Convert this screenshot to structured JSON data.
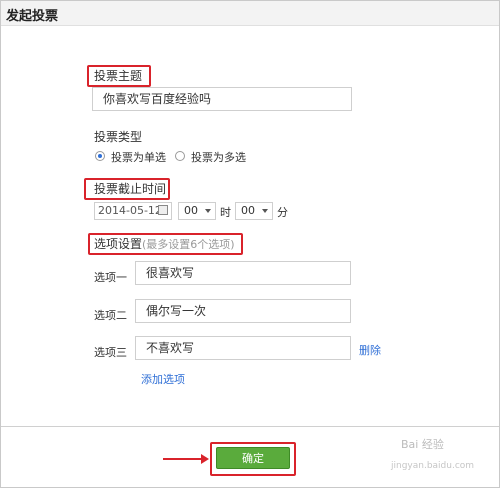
{
  "dialog": {
    "title": "发起投票"
  },
  "vote": {
    "topic_label": "投票主题",
    "topic_value": "你喜欢写百度经验吗",
    "type_label": "投票类型",
    "type_single": "投票为单选",
    "type_multi": "投票为多选",
    "deadline_label": "投票截止时间",
    "date_value": "2014-05-12",
    "hour_value": "00",
    "hour_unit": "时",
    "minute_value": "00",
    "minute_unit": "分",
    "options_label": "选项设置",
    "options_hint": "(最多设置6个选项)",
    "options": [
      {
        "label": "选项一",
        "value": "很喜欢写"
      },
      {
        "label": "选项二",
        "value": "偶尔写一次"
      },
      {
        "label": "选项三",
        "value": "不喜欢写",
        "delete": "删除"
      }
    ],
    "add_option": "添加选项",
    "confirm": "确定"
  },
  "watermark": {
    "text": "Bai 经验",
    "url": "jingyan.baidu.com"
  },
  "colors": {
    "highlight": "#d9232b",
    "confirm_button": "#5aab3c",
    "link": "#2f6fd6"
  }
}
